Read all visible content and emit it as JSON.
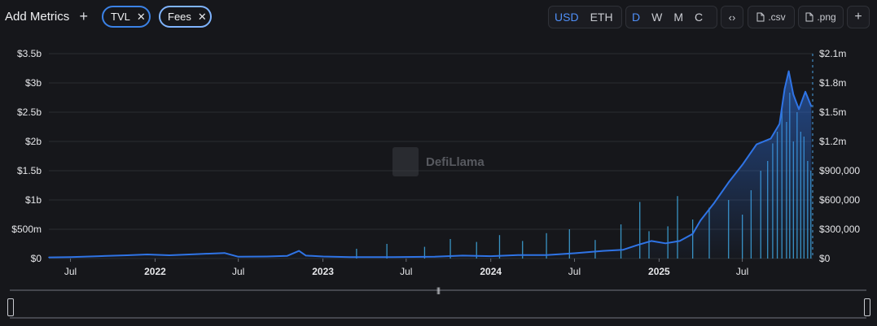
{
  "toolbar": {
    "add_metrics_label": "Add Metrics",
    "metrics": [
      {
        "label": "TVL",
        "color": "#3b82e6"
      },
      {
        "label": "Fees",
        "color": "#7fb4ff"
      }
    ],
    "currencies": [
      "USD",
      "ETH"
    ],
    "active_currency": "USD",
    "periods": [
      "D",
      "W",
      "M",
      "C"
    ],
    "active_period": "D",
    "embed_icon": "code-icon",
    "csv_label": ".csv",
    "png_label": ".png",
    "add_label": "+"
  },
  "watermark": {
    "text": "DefiLlama"
  },
  "chart_data": {
    "type": "area",
    "series": [
      {
        "name": "TVL",
        "axis": "left",
        "style": "area-line",
        "color": "#2f74e6",
        "points": [
          [
            "2021-05-15",
            20000000
          ],
          [
            "2021-07-01",
            25000000
          ],
          [
            "2021-09-01",
            40000000
          ],
          [
            "2021-11-01",
            55000000
          ],
          [
            "2021-12-15",
            70000000
          ],
          [
            "2022-02-01",
            55000000
          ],
          [
            "2022-04-01",
            75000000
          ],
          [
            "2022-06-01",
            95000000
          ],
          [
            "2022-07-01",
            30000000
          ],
          [
            "2022-09-01",
            35000000
          ],
          [
            "2022-10-15",
            45000000
          ],
          [
            "2022-11-10",
            130000000
          ],
          [
            "2022-11-25",
            50000000
          ],
          [
            "2023-01-01",
            35000000
          ],
          [
            "2023-03-01",
            25000000
          ],
          [
            "2023-06-01",
            25000000
          ],
          [
            "2023-09-01",
            30000000
          ],
          [
            "2023-11-01",
            50000000
          ],
          [
            "2024-01-01",
            40000000
          ],
          [
            "2024-03-01",
            60000000
          ],
          [
            "2024-05-01",
            60000000
          ],
          [
            "2024-07-01",
            90000000
          ],
          [
            "2024-09-01",
            130000000
          ],
          [
            "2024-10-15",
            150000000
          ],
          [
            "2024-11-15",
            230000000
          ],
          [
            "2024-12-15",
            300000000
          ],
          [
            "2025-01-15",
            260000000
          ],
          [
            "2025-02-15",
            300000000
          ],
          [
            "2025-03-15",
            420000000
          ],
          [
            "2025-04-01",
            650000000
          ],
          [
            "2025-05-01",
            950000000
          ],
          [
            "2025-06-01",
            1300000000
          ],
          [
            "2025-07-01",
            1600000000
          ],
          [
            "2025-08-01",
            1950000000
          ],
          [
            "2025-09-01",
            2050000000
          ],
          [
            "2025-09-20",
            2300000000
          ],
          [
            "2025-10-01",
            2900000000
          ],
          [
            "2025-10-10",
            3200000000
          ],
          [
            "2025-10-20",
            2800000000
          ],
          [
            "2025-11-01",
            2550000000
          ],
          [
            "2025-11-15",
            2850000000
          ],
          [
            "2025-11-28",
            2600000000
          ]
        ]
      },
      {
        "name": "Fees",
        "axis": "right",
        "style": "bars",
        "color": "#3fa9e0",
        "points": [
          [
            "2023-03-15",
            100000
          ],
          [
            "2023-05-20",
            150000
          ],
          [
            "2023-08-10",
            120000
          ],
          [
            "2023-10-05",
            200000
          ],
          [
            "2023-12-01",
            170000
          ],
          [
            "2024-01-20",
            240000
          ],
          [
            "2024-03-10",
            180000
          ],
          [
            "2024-05-01",
            260000
          ],
          [
            "2024-06-20",
            300000
          ],
          [
            "2024-08-15",
            190000
          ],
          [
            "2024-10-10",
            350000
          ],
          [
            "2024-11-20",
            580000
          ],
          [
            "2024-12-10",
            280000
          ],
          [
            "2025-01-20",
            330000
          ],
          [
            "2025-02-10",
            640000
          ],
          [
            "2025-03-15",
            400000
          ],
          [
            "2025-04-20",
            520000
          ],
          [
            "2025-06-01",
            600000
          ],
          [
            "2025-07-01",
            450000
          ],
          [
            "2025-07-20",
            700000
          ],
          [
            "2025-08-10",
            900000
          ],
          [
            "2025-08-25",
            1000000
          ],
          [
            "2025-09-05",
            1180000
          ],
          [
            "2025-09-15",
            1300000
          ],
          [
            "2025-09-25",
            1550000
          ],
          [
            "2025-10-05",
            1400000
          ],
          [
            "2025-10-12",
            1700000
          ],
          [
            "2025-10-20",
            1200000
          ],
          [
            "2025-10-28",
            1500000
          ],
          [
            "2025-11-05",
            1300000
          ],
          [
            "2025-11-12",
            1250000
          ],
          [
            "2025-11-20",
            1000000
          ],
          [
            "2025-11-27",
            900000
          ]
        ]
      }
    ],
    "x_range": [
      "2021-05-15",
      "2025-12-01"
    ],
    "x_ticks": [
      {
        "date": "2021-07-01",
        "label": "Jul",
        "bold": false
      },
      {
        "date": "2022-01-01",
        "label": "2022",
        "bold": true
      },
      {
        "date": "2022-07-01",
        "label": "Jul",
        "bold": false
      },
      {
        "date": "2023-01-01",
        "label": "2023",
        "bold": true
      },
      {
        "date": "2023-07-01",
        "label": "Jul",
        "bold": false
      },
      {
        "date": "2024-01-01",
        "label": "2024",
        "bold": true
      },
      {
        "date": "2024-07-01",
        "label": "Jul",
        "bold": false
      },
      {
        "date": "2025-01-01",
        "label": "2025",
        "bold": true
      },
      {
        "date": "2025-07-01",
        "label": "Jul",
        "bold": false
      }
    ],
    "y_left": {
      "range": [
        0,
        3500000000
      ],
      "ticks": [
        [
          0,
          "$0"
        ],
        [
          500000000,
          "$500m"
        ],
        [
          1000000000,
          "$1b"
        ],
        [
          1500000000,
          "$1.5b"
        ],
        [
          2000000000,
          "$2b"
        ],
        [
          2500000000,
          "$2.5b"
        ],
        [
          3000000000,
          "$3b"
        ],
        [
          3500000000,
          "$3.5b"
        ]
      ]
    },
    "y_right": {
      "range": [
        0,
        2100000
      ],
      "ticks": [
        [
          0,
          "$0"
        ],
        [
          300000,
          "$300,000"
        ],
        [
          600000,
          "$600,000"
        ],
        [
          900000,
          "$900,000"
        ],
        [
          1200000,
          "$1.2m"
        ],
        [
          1500000,
          "$1.5m"
        ],
        [
          1800000,
          "$1.8m"
        ],
        [
          2100000,
          "$2.1m"
        ]
      ]
    },
    "grid": true,
    "legend": "none"
  }
}
